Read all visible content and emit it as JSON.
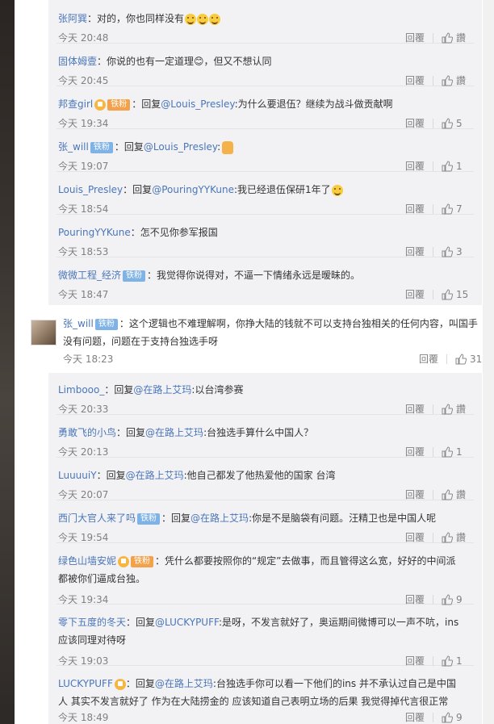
{
  "actions": {
    "reply_label": "回覆",
    "like_placeholder": "讚"
  },
  "badges": {
    "fan": "铁粉",
    "gold_fan": "铁粉"
  },
  "top_replies": [
    {
      "user": "张阿巽",
      "sep": "：",
      "text": "对的，你也同样没有",
      "time": "今天 20:48",
      "likes": "讚",
      "emoji": true
    },
    {
      "user": "固体姆壹",
      "sep": "：",
      "text": "你说的也有一定道理😊，但又不想认同",
      "time": "今天 20:45",
      "likes": "讚"
    },
    {
      "user": "邦查girl",
      "sep": "：",
      "prefix": "回复",
      "mention": "@Louis_Presley",
      "text": ":为什么要退伍？继续为战斗做贡献啊",
      "time": "今天 19:34",
      "likes": "5",
      "badge": "gold"
    },
    {
      "user": "张_will",
      "sep": "：",
      "prefix": "回复",
      "mention": "@Louis_Presley",
      "text": ":",
      "time": "今天 19:07",
      "likes": "1",
      "badge": "fan",
      "thumb": true
    },
    {
      "user": "Louis_Presley",
      "sep": "：",
      "prefix": "回复",
      "mention": "@PouringYYKune",
      "text": ":我已经退伍保研1年了",
      "time": "今天 18:54",
      "likes": "7",
      "emoji": true
    },
    {
      "user": "PouringYYKune",
      "sep": "：",
      "text": "怎不见你参军报国",
      "time": "今天 18:53",
      "likes": "3"
    },
    {
      "user": "微微工程_经济",
      "sep": "：",
      "text": "我觉得你说得对，不逼一下情绪永远是暧昧的。",
      "time": "今天 18:47",
      "likes": "15",
      "badge": "fan"
    }
  ],
  "main_comment": {
    "user": "张_will",
    "badge": "铁粉",
    "sep": "：",
    "text": "这个逻辑也不难理解啊，你挣大陆的钱就不可以支持台独相关的任何内容，叫国手没有问题，问题在于支持台独选手呀",
    "time": "今天 18:23",
    "likes": "31"
  },
  "bottom_replies": [
    {
      "user": "Limbooo_",
      "sep": "：",
      "prefix": "回复",
      "mention": "@在路上艾玛",
      "text": ":以台湾参赛",
      "time": "今天 20:33",
      "likes": "讚"
    },
    {
      "user": "勇敢飞的小鸟",
      "sep": "：",
      "prefix": "回复",
      "mention": "@在路上艾玛",
      "text": ":台独选手算什么中国人？",
      "time": "今天 20:13",
      "likes": "1"
    },
    {
      "user": "LuuuuiY",
      "sep": "：",
      "prefix": "回复",
      "mention": "@在路上艾玛",
      "text": ":他自己都发了他热爱他的国家 台湾",
      "time": "今天 20:07",
      "likes": "讚"
    },
    {
      "user": "西门大官人来了吗",
      "sep": "：",
      "prefix": "回复",
      "mention": "@在路上艾玛",
      "text": ":你是不是脑袋有问题。汪精卫也是中国人呢",
      "time": "今天 19:54",
      "likes": "讚",
      "badge": "fan"
    },
    {
      "user": "绿色山墙安妮",
      "sep": "：",
      "text": "凭什么都要按照你的“规定”去做事，而且管得这么宽，好好的中间派都被你们逼成台独。",
      "time": "今天 19:34",
      "likes": "9",
      "badge": "gold"
    },
    {
      "user": "零下五度的冬天",
      "sep": "：",
      "prefix": "回复",
      "mention": "@LUCKYPUFF",
      "text": ":是呀，不发言就好了，奥运期间微博可以一声不吭，ins应该同理对待呀",
      "time": "今天 19:03",
      "likes": "1"
    },
    {
      "user": "LUCKYPUFF",
      "sep": "：",
      "prefix": "回复",
      "mention": "@在路上艾玛",
      "text": ":台独选手你可以看一下他们的ins 并不承认过自己是中国人 其实不发言就好了 作为在大陆捞金的 应该知道自己表明立场的后果 我觉得掉代言很正常",
      "time": "今天 18:49",
      "likes": "9",
      "badge": "goldicon"
    }
  ]
}
